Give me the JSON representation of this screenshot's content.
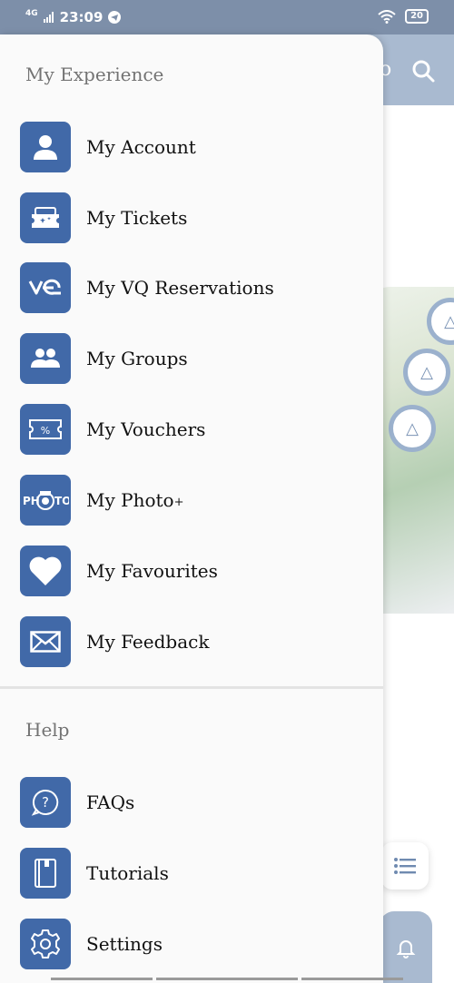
{
  "status": {
    "net": "4G",
    "time": "23:09",
    "battery": "20"
  },
  "background": {
    "header_partial": "o"
  },
  "drawer": {
    "experience": {
      "title": "My Experience",
      "items": [
        {
          "label": "My Account",
          "icon": "account-icon"
        },
        {
          "label": "My Tickets",
          "icon": "ticket-icon"
        },
        {
          "label": "My VQ Reservations",
          "icon": "vq-icon"
        },
        {
          "label": "My Groups",
          "icon": "groups-icon"
        },
        {
          "label": "My Vouchers",
          "icon": "voucher-icon"
        },
        {
          "label": "My Photo",
          "suffix": "+",
          "icon": "photo-icon"
        },
        {
          "label": "My Favourites",
          "icon": "heart-icon"
        },
        {
          "label": "My Feedback",
          "icon": "envelope-icon"
        }
      ]
    },
    "help": {
      "title": "Help",
      "items": [
        {
          "label": "FAQs",
          "icon": "question-icon"
        },
        {
          "label": "Tutorials",
          "icon": "book-icon"
        },
        {
          "label": "Settings",
          "icon": "gear-icon"
        }
      ]
    }
  },
  "colors": {
    "accent": "#4169a8",
    "drawer_bg": "#fafafa",
    "header_bg": "#a9bad0",
    "statusbar": "#7d8fa9"
  }
}
